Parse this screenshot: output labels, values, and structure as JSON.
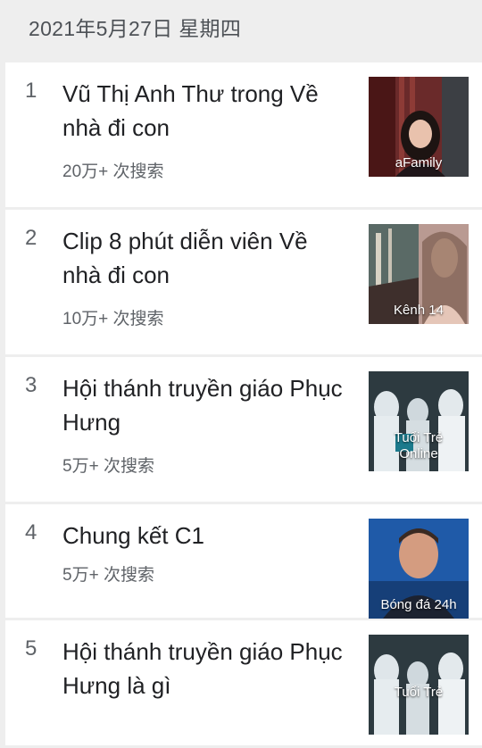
{
  "header": {
    "date": "2021年5月27日 星期四"
  },
  "trends": [
    {
      "rank": "1",
      "title": "Vũ Thị Anh Thư trong Về nhà đi con",
      "searches": "20万+ 次搜索",
      "source": "aFamily",
      "image": "woman-portrait"
    },
    {
      "rank": "2",
      "title": "Clip 8 phút diễn viên Về nhà đi con",
      "searches": "10万+ 次搜索",
      "source": "Kênh 14",
      "image": "street-scene"
    },
    {
      "rank": "3",
      "title": "Hội thánh truyền giáo Phục Hưng",
      "searches": "5万+ 次搜索",
      "source": "Tuổi Trẻ Online",
      "image": "medical-workers"
    },
    {
      "rank": "4",
      "title": "Chung kết C1",
      "searches": "5万+ 次搜索",
      "source": "Bóng đá 24h",
      "image": "man-portrait"
    },
    {
      "rank": "5",
      "title": "Hội thánh truyền giáo Phục Hưng là gì",
      "searches": "",
      "source": "Tuổi Trẻ",
      "image": "medical-workers"
    }
  ]
}
